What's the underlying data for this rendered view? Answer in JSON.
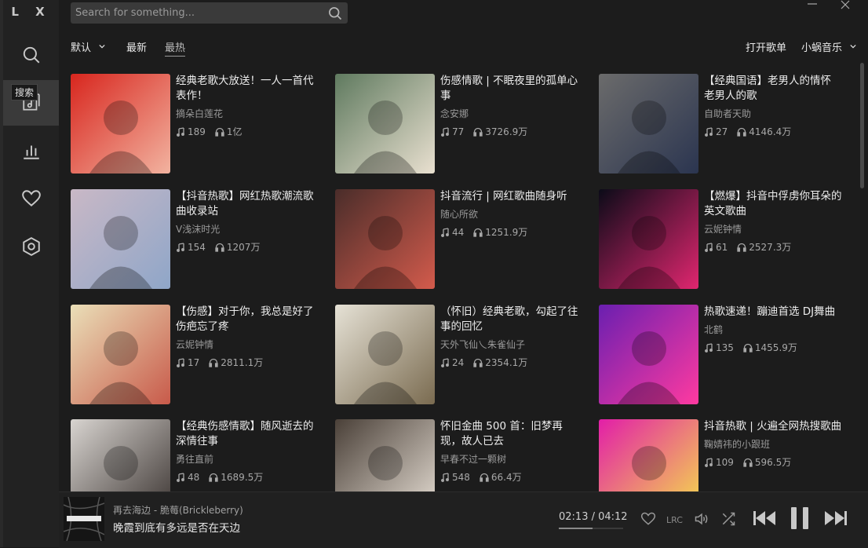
{
  "app": {
    "logo": "L X"
  },
  "sidebar": {
    "tooltip": "搜索",
    "items": [
      {
        "name": "search"
      },
      {
        "name": "songlist"
      },
      {
        "name": "leaderboard"
      },
      {
        "name": "favorites"
      },
      {
        "name": "settings"
      }
    ]
  },
  "search": {
    "placeholder": "Search for something..."
  },
  "tabs": {
    "sort_default": "默认",
    "latest": "最新",
    "hottest": "最热"
  },
  "tools": {
    "open_playlist": "打开歌单",
    "source": "小蜗音乐"
  },
  "playlists": [
    {
      "title": "经典老歌大放送！一人一首代表作！",
      "author": "摘朵白莲花",
      "songs": "189",
      "plays": "1亿",
      "colors": [
        "#d8261e",
        "#f2b3a0"
      ]
    },
    {
      "title": "伤感情歌 | 不眠夜里的孤单心事",
      "author": "念安娜",
      "songs": "77",
      "plays": "3726.9万",
      "colors": [
        "#5f7a5f",
        "#e9e0d0"
      ]
    },
    {
      "title": "【经典国语】老男人的情怀 老男人的歌",
      "author": "自助者天助",
      "songs": "27",
      "plays": "4146.4万",
      "colors": [
        "#6b6b6b",
        "#2b3550"
      ]
    },
    {
      "title": "【抖音热歌】网红热歌潮流歌曲收录站",
      "author": "V浅沫时光",
      "songs": "154",
      "plays": "1207万",
      "colors": [
        "#c9b8c6",
        "#8fa6c8"
      ]
    },
    {
      "title": "抖音流行 | 网红歌曲随身听",
      "author": "随心所欲",
      "songs": "44",
      "plays": "1251.9万",
      "colors": [
        "#4a2d2a",
        "#d35b4c"
      ]
    },
    {
      "title": "【燃爆】抖音中俘虏你耳朵的英文歌曲",
      "author": "云妮钟情",
      "songs": "61",
      "plays": "2527.3万",
      "colors": [
        "#0b0b18",
        "#e0266f"
      ]
    },
    {
      "title": "【伤感】对于你，我总是好了伤疤忘了疼",
      "author": "云妮钟情",
      "songs": "17",
      "plays": "2811.1万",
      "colors": [
        "#eadfb8",
        "#c85a4a"
      ]
    },
    {
      "title": "（怀旧）经典老歌，勾起了往事的回忆",
      "author": "天外飞仙乀朱雀仙子",
      "songs": "24",
      "plays": "2354.1万",
      "colors": [
        "#e6e2d6",
        "#7a6b50"
      ]
    },
    {
      "title": "热歌速递！蹦迪首选 DJ舞曲",
      "author": "北鹤",
      "songs": "135",
      "plays": "1455.9万",
      "colors": [
        "#6a1fb0",
        "#ff3aa0"
      ]
    },
    {
      "title": "【经典伤感情歌】随风逝去的深情往事",
      "author": "勇往直前",
      "songs": "48",
      "plays": "1689.5万",
      "colors": [
        "#d8d4d0",
        "#3a3330"
      ]
    },
    {
      "title": "怀旧金曲 500 首：旧梦再现，故人已去",
      "author": "早春不过一颗树",
      "songs": "548",
      "plays": "66.4万",
      "colors": [
        "#4a4038",
        "#e8e0d6"
      ]
    },
    {
      "title": "抖音热歌 | 火遍全网热搜歌曲",
      "author": "鞠婧祎的小跟班",
      "songs": "109",
      "plays": "596.5万",
      "colors": [
        "#e21ea8",
        "#f5e04a"
      ]
    }
  ],
  "player": {
    "song": "再去海边 - 脆莓(Brickleberry)",
    "lyric": "晚霞到底有多远是否在天边",
    "time": "02:13 / 04:12",
    "progress": 0.528
  }
}
